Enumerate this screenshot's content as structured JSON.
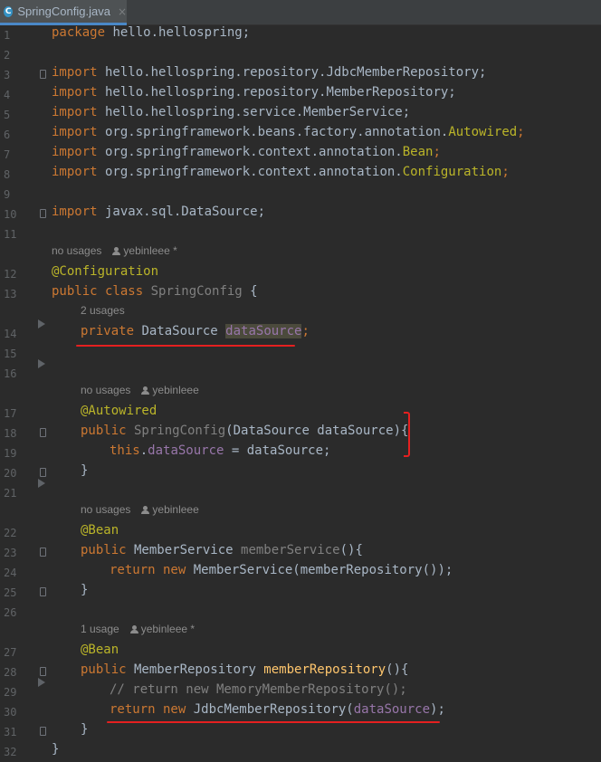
{
  "tab": {
    "label": "SpringConfig.java",
    "close": "×",
    "icon_letter": "C"
  },
  "hints": {
    "class_usage": "no usages",
    "class_author": "yebinleee *",
    "field_usage": "2 usages",
    "ctor_usage": "no usages",
    "ctor_author": "yebinleee",
    "bean1_usage": "no usages",
    "bean1_author": "yebinleee",
    "bean2_usage": "1 usage",
    "bean2_author": "yebinleee *"
  },
  "code": {
    "l1_kw": "package",
    "l1_rest": " hello.hellospring;",
    "imp": "import",
    "l3_pkg": " hello.hellospring.repository.JdbcMemberRepository;",
    "l4_pkg": " hello.hellospring.repository.MemberRepository;",
    "l5_pkg": " hello.hellospring.service.MemberService;",
    "l6_pkg": " org.springframework.beans.factory.annotation.",
    "l6_cls": "Autowired",
    "l6_end": ";",
    "l7_pkg": " org.springframework.context.annotation.",
    "l7_cls": "Bean",
    "l7_end": ";",
    "l8_pkg": " org.springframework.context.annotation.",
    "l8_cls": "Configuration",
    "l8_end": ";",
    "l10_pkg": " javax.sql.DataSource;",
    "l12_ann": "@Configuration",
    "l13_kw": "public class",
    "l13_name": " SpringConfig",
    "l13_rest": " {",
    "l14_kw": "private",
    "l14_type": " DataSource ",
    "l14_field": "dataSource",
    "l14_end": ";",
    "l17_ann": "@Autowired",
    "l18_kw": "public",
    "l18_name": " SpringConfig",
    "l18_rest": "(DataSource dataSource){",
    "l19_kw": "this",
    "l19_dot": ".",
    "l19_field": "dataSource",
    "l19_rest": " = dataSource;",
    "close_brace": "}",
    "l22_ann": "@Bean",
    "l23_kw": "public",
    "l23_type": " MemberService ",
    "l23_name": "memberService",
    "l23_rest": "(){",
    "l24_kw": "return new",
    "l24_rest": " MemberService(memberRepository());",
    "l27_ann": "@Bean",
    "l28_kw": "public",
    "l28_type": " MemberRepository ",
    "l28_name": "memberRepository",
    "l28_rest": "(){",
    "l29_cmt": "// return new MemoryMemberRepository();",
    "l30_kw": "return new",
    "l30_type": " JdbcMemberRepository(",
    "l30_field": "dataSource",
    "l30_rest": ");"
  },
  "line_numbers": [
    "1",
    "2",
    "3",
    "4",
    "5",
    "6",
    "7",
    "8",
    "9",
    "10",
    "11",
    "12",
    "13",
    "14",
    "15",
    "16",
    "17",
    "18",
    "19",
    "20",
    "21",
    "22",
    "23",
    "24",
    "25",
    "26",
    "27",
    "28",
    "29",
    "30",
    "31",
    "32"
  ],
  "colors": {
    "background": "#2b2b2b",
    "keyword": "#cc7832",
    "annotation": "#bbb529",
    "field": "#9876aa",
    "method": "#ffc66d",
    "text": "#a9b7c6",
    "markup_red": "#e52020"
  }
}
